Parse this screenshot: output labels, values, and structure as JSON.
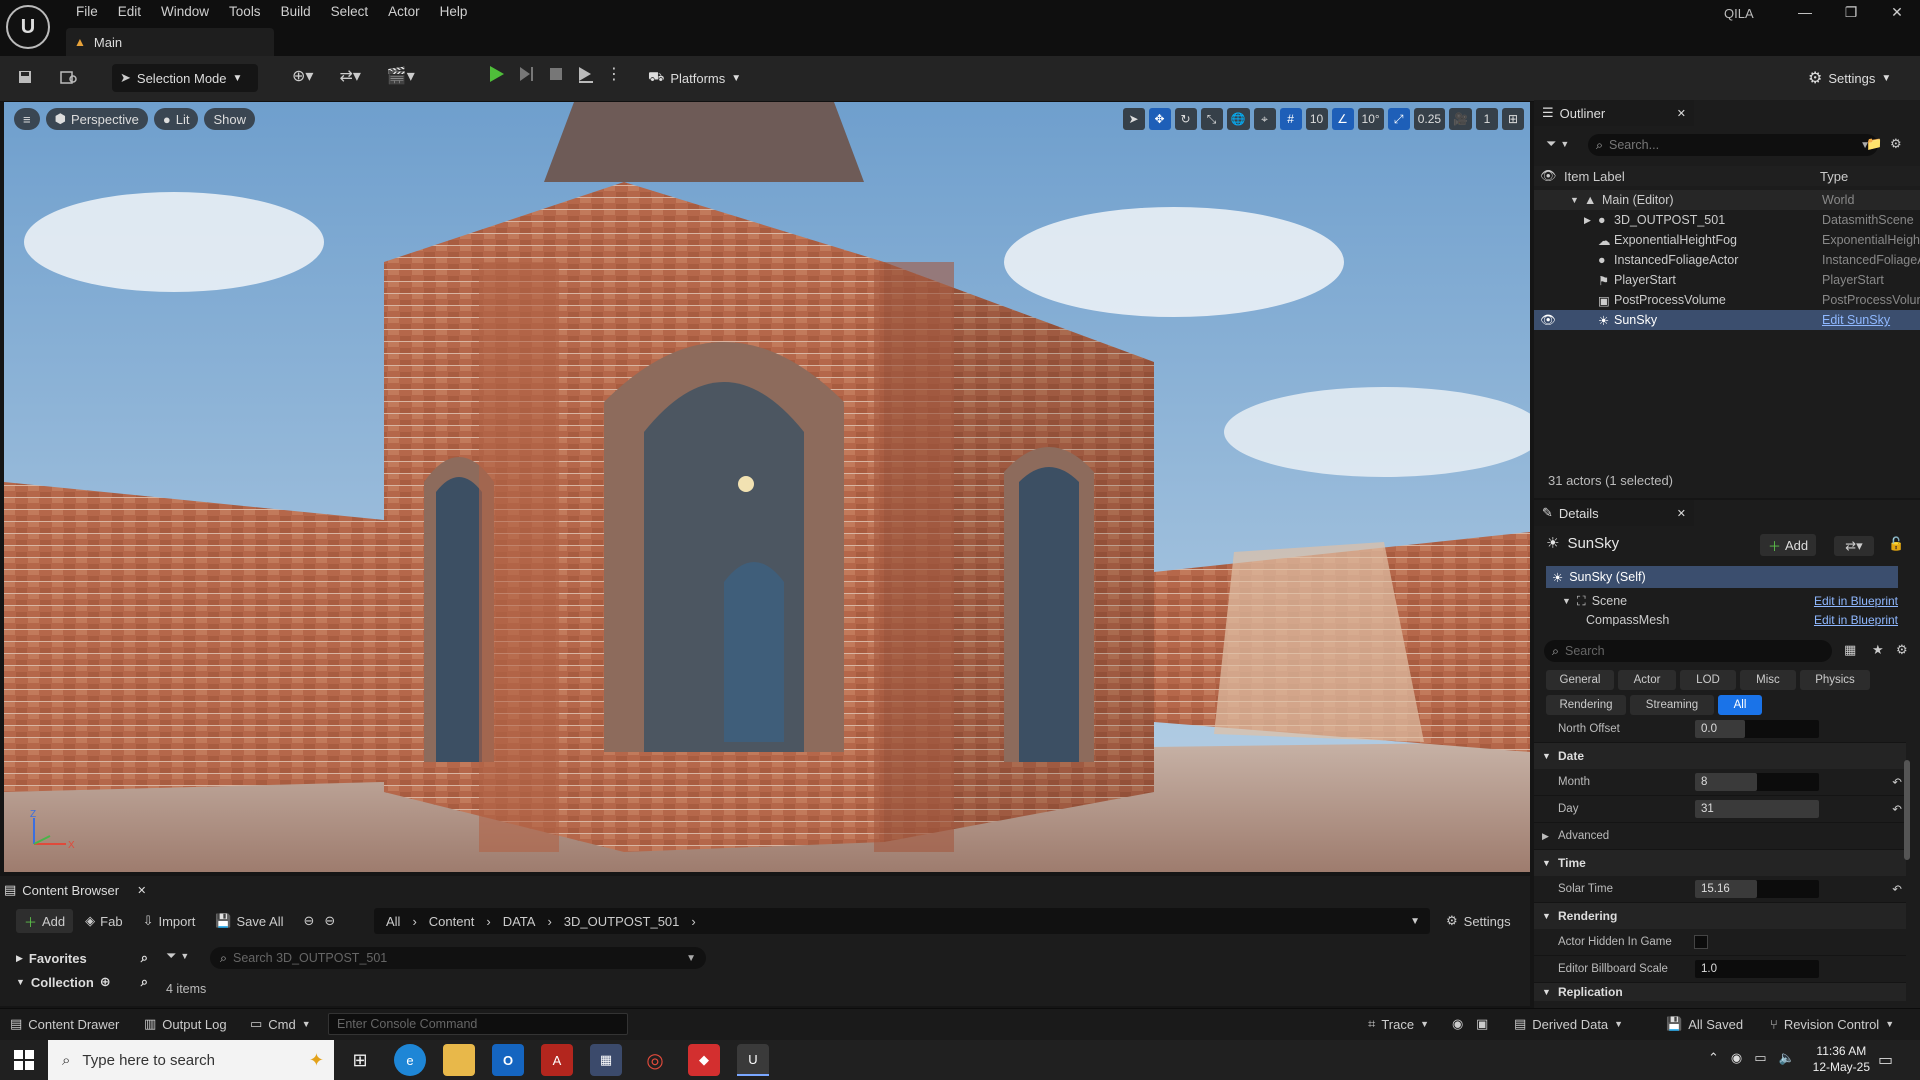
{
  "app": {
    "menu": [
      "File",
      "Edit",
      "Window",
      "Tools",
      "Build",
      "Select",
      "Actor",
      "Help"
    ],
    "level_tab": "Main",
    "project": "QILA"
  },
  "toolbar": {
    "selection_mode": "Selection Mode",
    "platforms": "Platforms",
    "settings": "Settings"
  },
  "viewport": {
    "perspective": "Perspective",
    "lit": "Lit",
    "show": "Show",
    "grid_snap": "10",
    "rotation_snap": "10°",
    "scale_snap": "0.25",
    "camera_speed": "1",
    "axis_z": "Z",
    "axis_x": "X"
  },
  "outliner": {
    "title": "Outliner",
    "search_placeholder": "Search...",
    "col_label": "Item Label",
    "col_type": "Type",
    "items": [
      {
        "label": "Main (Editor)",
        "type": "World"
      },
      {
        "label": "3D_OUTPOST_501",
        "type": "DatasmithScene"
      },
      {
        "label": "ExponentialHeightFog",
        "type": "ExponentialHeightFog"
      },
      {
        "label": "InstancedFoliageActor",
        "type": "InstancedFoliageActor"
      },
      {
        "label": "PlayerStart",
        "type": "PlayerStart"
      },
      {
        "label": "PostProcessVolume",
        "type": "PostProcessVolume"
      },
      {
        "label": "SunSky",
        "type": "Edit SunSky"
      }
    ],
    "status": "31 actors (1 selected)"
  },
  "details": {
    "title": "Details",
    "actor": "SunSky",
    "add": "Add",
    "components": [
      {
        "label": "SunSky (Self)",
        "action": ""
      },
      {
        "label": "Scene",
        "action": "Edit in Blueprint"
      },
      {
        "label": "CompassMesh",
        "action": "Edit in Blueprint"
      }
    ],
    "search_placeholder": "Search",
    "filters_row1": [
      "General",
      "Actor",
      "LOD",
      "Misc",
      "Physics"
    ],
    "filters_row2": [
      "Rendering",
      "Streaming",
      "All"
    ],
    "north_offset": {
      "label": "North Offset",
      "value": "0.0"
    },
    "sections": {
      "date": "Date",
      "advanced": "Advanced",
      "time": "Time",
      "rendering": "Rendering",
      "replication": "Replication"
    },
    "month": {
      "label": "Month",
      "value": "8",
      "fill": 0.5
    },
    "day": {
      "label": "Day",
      "value": "31",
      "fill": 1.0
    },
    "solar_time": {
      "label": "Solar Time",
      "value": "15.16",
      "fill": 0.5
    },
    "actor_hidden": {
      "label": "Actor Hidden In Game",
      "checked": false
    },
    "billboard": {
      "label": "Editor Billboard Scale",
      "value": "1.0"
    }
  },
  "content_browser": {
    "title": "Content Browser",
    "add": "Add",
    "fab": "Fab",
    "import": "Import",
    "save_all": "Save All",
    "path": [
      "All",
      "Content",
      "DATA",
      "3D_OUTPOST_501"
    ],
    "settings": "Settings",
    "favorites": "Favorites",
    "collections": "Collection",
    "search_placeholder": "Search 3D_OUTPOST_501",
    "count": "4 items"
  },
  "statusbar": {
    "content_drawer": "Content Drawer",
    "output_log": "Output Log",
    "cmd": "Cmd",
    "console_placeholder": "Enter Console Command",
    "trace": "Trace",
    "derived_data": "Derived Data",
    "all_saved": "All Saved",
    "revision_control": "Revision Control"
  },
  "taskbar": {
    "search_placeholder": "Type here to search",
    "time": "11:36 AM",
    "date": "12-May-25"
  }
}
